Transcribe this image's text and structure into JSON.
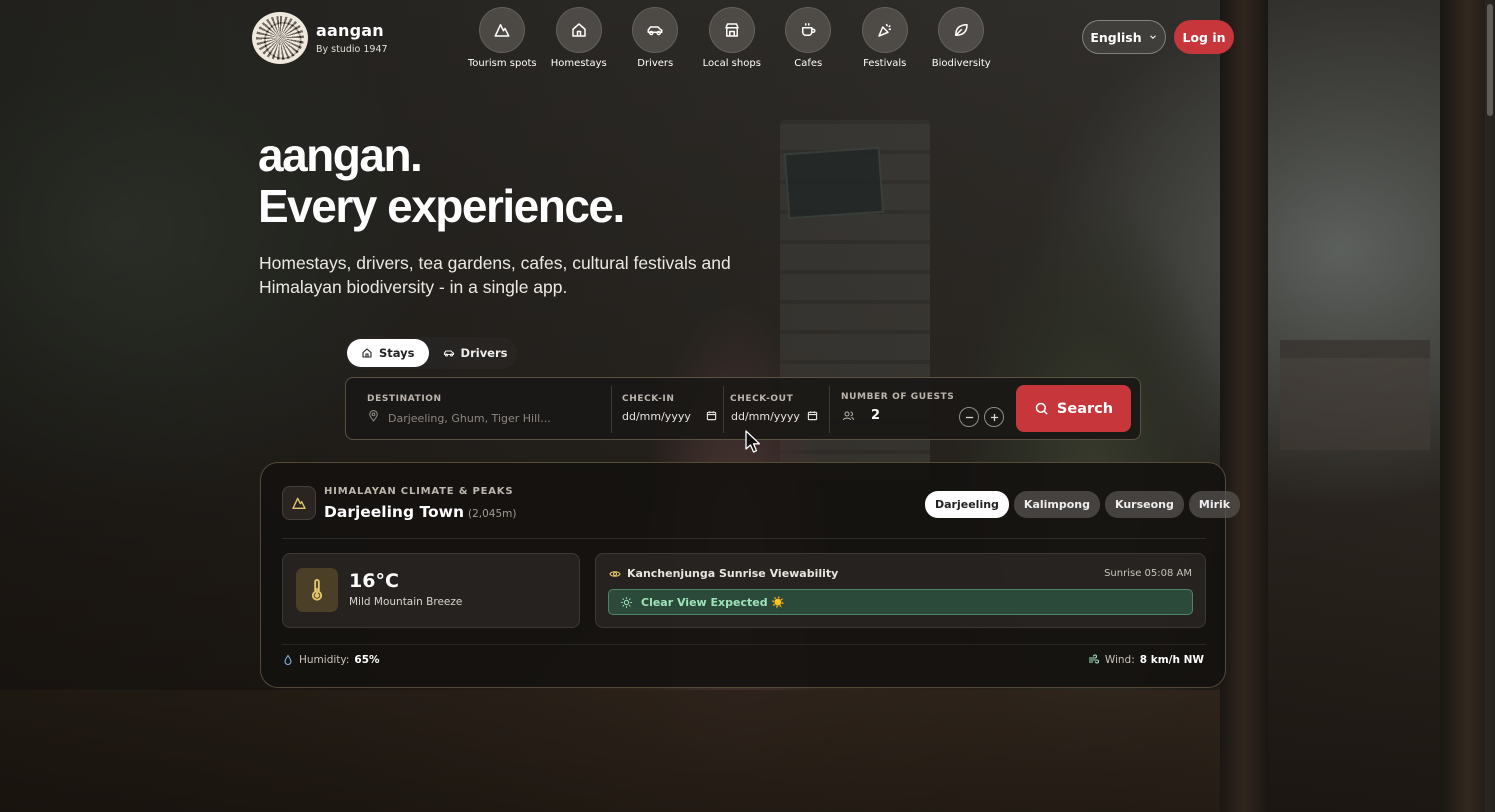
{
  "brand": {
    "name": "aangan",
    "sub": "By studio 1947"
  },
  "nav": [
    {
      "label": "Tourism spots",
      "icon": "mountain-icon"
    },
    {
      "label": "Homestays",
      "icon": "home-icon"
    },
    {
      "label": "Drivers",
      "icon": "car-icon"
    },
    {
      "label": "Local shops",
      "icon": "store-icon"
    },
    {
      "label": "Cafes",
      "icon": "coffee-icon"
    },
    {
      "label": "Festivals",
      "icon": "party-popper-icon"
    },
    {
      "label": "Biodiversity",
      "icon": "leaf-icon"
    }
  ],
  "header": {
    "language": "English",
    "login": "Log in"
  },
  "hero": {
    "title_line1": "aangan.",
    "title_line2": "Every experience.",
    "subtitle": "Homestays, drivers, tea gardens, cafes, cultural festivals and Himalayan biodiversity - in a single app."
  },
  "mode_tabs": {
    "stays": "Stays",
    "drivers": "Drivers",
    "active": "Stays"
  },
  "search": {
    "destination_label": "DESTINATION",
    "destination_placeholder": "Darjeeling, Ghum, Tiger Hill...",
    "checkin_label": "CHECK-IN",
    "checkin_value": "dd/mm/yyyy",
    "checkout_label": "CHECK-OUT",
    "checkout_value": "dd/mm/yyyy",
    "guests_label": "NUMBER OF GUESTS",
    "guests_value": "2",
    "button": "Search"
  },
  "climate": {
    "kicker": "HIMALAYAN CLIMATE & PEAKS",
    "title": "Darjeeling Town",
    "elevation": "(2,045m)",
    "towns": [
      "Darjeeling",
      "Kalimpong",
      "Kurseong",
      "Mirik"
    ],
    "active_town": "Darjeeling",
    "temperature": "16°C",
    "temperature_desc": "Mild Mountain Breeze",
    "view_title": "Kanchenjunga Sunrise Viewability",
    "sunrise": "Sunrise 05:08 AM",
    "view_status": "Clear View Expected ☀️",
    "humidity_label": "Humidity:",
    "humidity_value": "65%",
    "wind_label": "Wind:",
    "wind_value": "8 km/h NW"
  },
  "colors": {
    "accent": "#c6363a",
    "status_green": "#9fe3bb"
  }
}
